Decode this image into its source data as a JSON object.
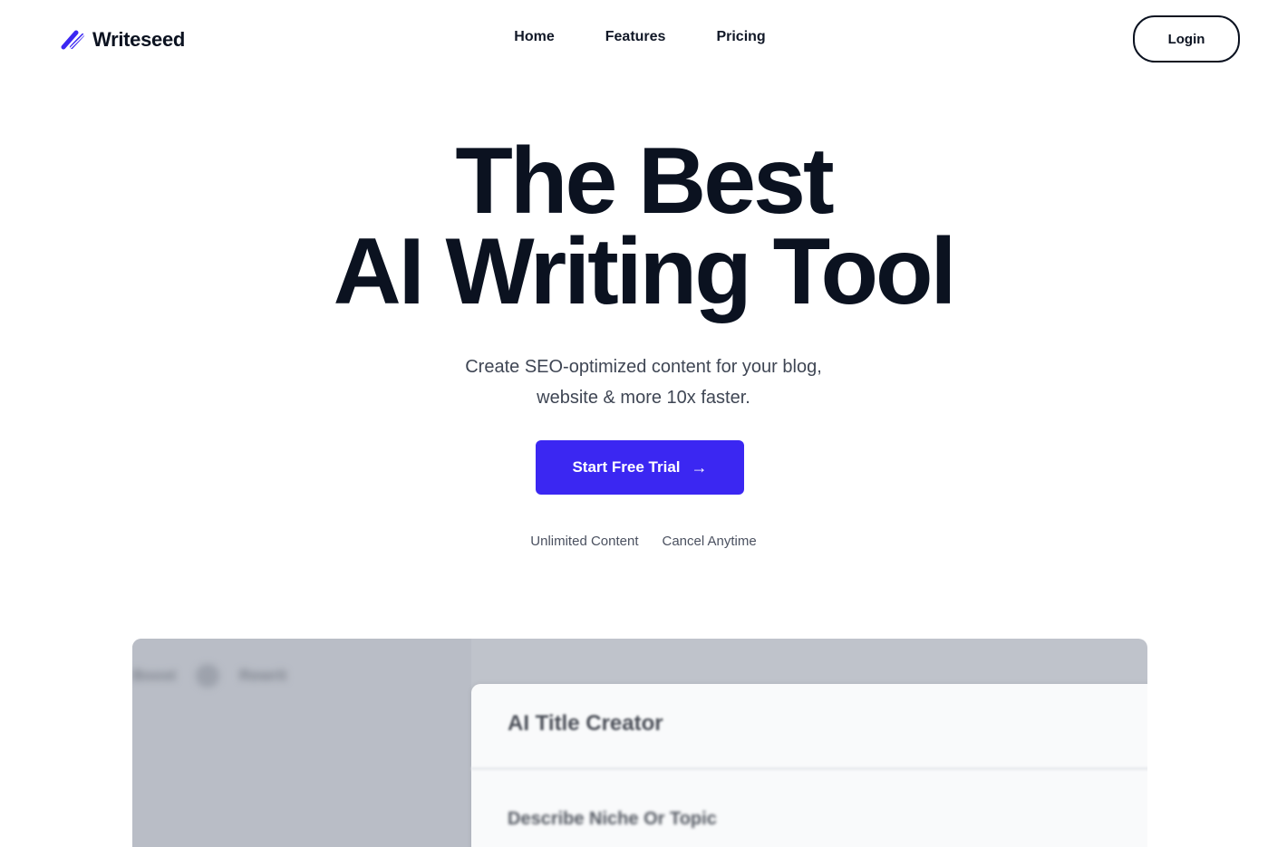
{
  "brand": {
    "name": "Writeseed",
    "logo_icon": "slash-stripe-icon",
    "accent_color": "#3b27f2"
  },
  "nav": {
    "items": [
      {
        "label": "Home"
      },
      {
        "label": "Features"
      },
      {
        "label": "Pricing"
      }
    ],
    "login_label": "Login"
  },
  "hero": {
    "title_line1": "The Best",
    "title_line2": "AI Writing Tool",
    "subtitle_line1": "Create SEO-optimized content for your blog,",
    "subtitle_line2": "website & more 10x faster.",
    "cta_label": "Start Free Trial",
    "cta_icon": "arrow-right-icon",
    "perks": [
      "Unlimited Content",
      "Cancel Anytime"
    ]
  },
  "preview": {
    "tabs": [
      "Boost",
      "Rewrit"
    ],
    "panel_title": "AI Title Creator",
    "field_label": "Describe Niche Or Topic"
  }
}
